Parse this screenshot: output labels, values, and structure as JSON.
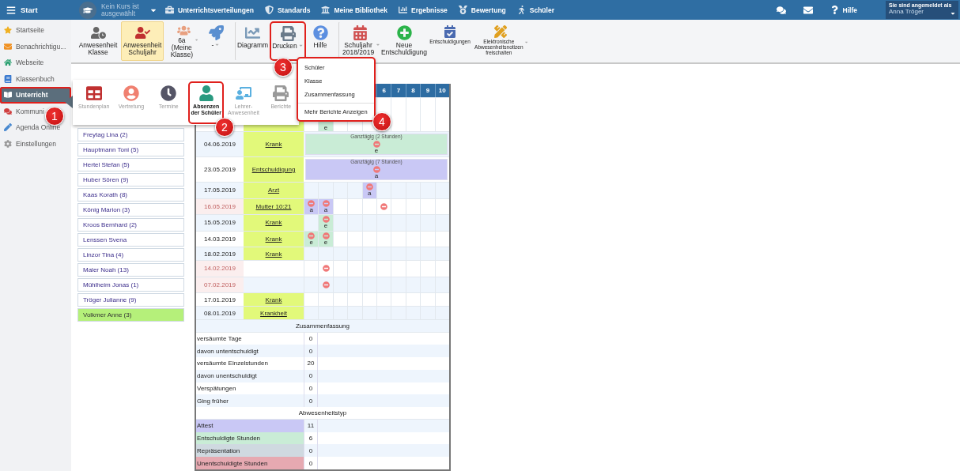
{
  "topbar": {
    "start": "Start",
    "course": "Kein Kurs ist ausgewählt",
    "nav": [
      "Unterrichtsverteilungen",
      "Standards",
      "Meine Bibliothek",
      "Ergebnisse",
      "Bewertung",
      "Schüler"
    ],
    "help": "Hilfe",
    "login_label": "Sie sind angemeldet als",
    "user": "Anna Tröger"
  },
  "sidebar": [
    {
      "label": "Startseite",
      "selected": false,
      "outlined": false
    },
    {
      "label": "Benachrichtigu...",
      "selected": false,
      "outlined": false
    },
    {
      "label": "Webseite",
      "selected": false,
      "outlined": false
    },
    {
      "label": "Klassenbuch",
      "selected": false,
      "outlined": false
    },
    {
      "label": "Unterricht",
      "selected": true,
      "outlined": true
    },
    {
      "label": "Kommuni",
      "selected": false,
      "outlined": false
    },
    {
      "label": "Agenda Online",
      "selected": false,
      "outlined": false
    },
    {
      "label": "Einstellungen",
      "selected": false,
      "outlined": false
    }
  ],
  "toolbar": [
    {
      "label": "Anwesenheit Klasse",
      "kind": "large",
      "selected": false,
      "dropdown": false,
      "divider_before": false,
      "outlined": false
    },
    {
      "label": "Anwesenheit Schuljahr",
      "kind": "large",
      "selected": true,
      "dropdown": false,
      "divider_before": false,
      "outlined": false
    },
    {
      "label": "6a (Meine Klasse)",
      "kind": "large",
      "selected": false,
      "dropdown": true,
      "divider_before": false,
      "outlined": false
    },
    {
      "label": "-",
      "kind": "large",
      "selected": false,
      "dropdown": true,
      "divider_before": false,
      "outlined": false
    },
    {
      "label": "Diagramm",
      "kind": "large",
      "selected": false,
      "dropdown": false,
      "divider_before": true,
      "outlined": false
    },
    {
      "label": "Drucken",
      "kind": "large",
      "selected": false,
      "dropdown": true,
      "divider_before": false,
      "outlined": true
    },
    {
      "label": "Hilfe",
      "kind": "large",
      "selected": false,
      "dropdown": false,
      "divider_before": false,
      "outlined": false
    },
    {
      "label": "Schuljahr 2018/2019",
      "kind": "large",
      "selected": false,
      "dropdown": true,
      "divider_before": true,
      "outlined": false
    },
    {
      "label": "Neue Entschuldigung",
      "kind": "large",
      "selected": false,
      "dropdown": false,
      "divider_before": false,
      "outlined": false
    },
    {
      "label": "Entschuldigungen",
      "kind": "small",
      "selected": false,
      "dropdown": false,
      "divider_before": false,
      "outlined": false
    },
    {
      "label": "Elektronische Abwesenheitsnotizen freischalten",
      "kind": "small",
      "selected": false,
      "dropdown": true,
      "divider_before": false,
      "outlined": false
    }
  ],
  "module_menu": [
    {
      "label": "Stundenplan",
      "selected": false,
      "outlined": false
    },
    {
      "label": "Vertretung",
      "selected": false,
      "outlined": false
    },
    {
      "label": "Termine",
      "selected": false,
      "outlined": false
    },
    {
      "label": "Absenzen der Schüler",
      "selected": true,
      "outlined": true
    },
    {
      "label": "Lehrer-Anwesenheit",
      "selected": false,
      "outlined": false
    },
    {
      "label": "Berichte",
      "selected": false,
      "outlined": false
    }
  ],
  "print_menu": {
    "items": [
      "Schüler",
      "Klasse",
      "Zusammenfassung"
    ],
    "more": "Mehr Berichte Anzeigen",
    "outlined": true
  },
  "callouts": [
    "1",
    "2",
    "3",
    "4"
  ],
  "students": [
    {
      "name": "Freytag Lina (2)",
      "selected": false
    },
    {
      "name": "Hauptmann Toni (5)",
      "selected": false
    },
    {
      "name": "Hertel Stefan (5)",
      "selected": false
    },
    {
      "name": "Huber Sören (9)",
      "selected": false
    },
    {
      "name": "Kaas Korath (8)",
      "selected": false
    },
    {
      "name": "König Marion (3)",
      "selected": false
    },
    {
      "name": "Kroos Bernhard (2)",
      "selected": false
    },
    {
      "name": "Lenssen Svena",
      "selected": false
    },
    {
      "name": "Linzor Tina (4)",
      "selected": false
    },
    {
      "name": "Maler Noah (13)",
      "selected": false
    },
    {
      "name": "Mühlheim Jonas (1)",
      "selected": false
    },
    {
      "name": "Tröger Julianne (9)",
      "selected": false
    },
    {
      "name": "Volkmer Anne (3)",
      "selected": true
    }
  ],
  "absences": {
    "periods": [
      "6",
      "7",
      "8",
      "9",
      "10"
    ],
    "rows": [
      {
        "kind": "covered",
        "cells": [
          {
            "kind": "empty"
          },
          {
            "kind": "letter",
            "letter": "e",
            "color": "#c9ecd6"
          },
          {
            "kind": "empty"
          },
          {
            "kind": "empty"
          },
          {
            "kind": "empty"
          },
          {
            "kind": "empty"
          },
          {
            "kind": "empty"
          },
          {
            "kind": "empty"
          },
          {
            "kind": "empty"
          },
          {
            "kind": "empty"
          }
        ]
      },
      {
        "kind": "full_day",
        "date": "04.06.2019",
        "reason": "Krank",
        "flagged": false,
        "full_day": {
          "label": "Ganztägig (2 Stunden)",
          "letter": "e",
          "color": "#c9ecd6"
        }
      },
      {
        "kind": "full_day",
        "date": "23.05.2019",
        "reason": "Entschuldigung",
        "flagged": false,
        "full_day": {
          "label": "Ganztägig (7 Stunden)",
          "letter": "a",
          "color": "#c9c8f5"
        }
      },
      {
        "kind": "periods",
        "date": "17.05.2019",
        "reason": "Arzt",
        "flagged": false,
        "cells": [
          {
            "kind": "empty"
          },
          {
            "kind": "empty"
          },
          {
            "kind": "empty"
          },
          {
            "kind": "empty"
          },
          {
            "kind": "mark",
            "letter": "a",
            "color": "#c9c8f5"
          },
          {
            "kind": "empty"
          },
          {
            "kind": "empty"
          },
          {
            "kind": "empty"
          },
          {
            "kind": "empty"
          },
          {
            "kind": "empty"
          }
        ]
      },
      {
        "kind": "periods",
        "date": "16.05.2019",
        "reason": "Mutter 10:21",
        "flagged": true,
        "cells": [
          {
            "kind": "mark",
            "letter": "a",
            "color": "#c9c8f5"
          },
          {
            "kind": "mark",
            "letter": "a",
            "color": "#c9c8f5"
          },
          {
            "kind": "empty"
          },
          {
            "kind": "empty"
          },
          {
            "kind": "empty"
          },
          {
            "kind": "icon"
          },
          {
            "kind": "empty"
          },
          {
            "kind": "empty"
          },
          {
            "kind": "empty"
          },
          {
            "kind": "empty"
          }
        ]
      },
      {
        "kind": "periods",
        "date": "15.05.2019",
        "reason": "Krank",
        "flagged": false,
        "cells": [
          {
            "kind": "empty"
          },
          {
            "kind": "mark",
            "letter": "e",
            "color": "#c9ecd6"
          },
          {
            "kind": "empty"
          },
          {
            "kind": "empty"
          },
          {
            "kind": "empty"
          },
          {
            "kind": "empty"
          },
          {
            "kind": "empty"
          },
          {
            "kind": "empty"
          },
          {
            "kind": "empty"
          },
          {
            "kind": "empty"
          }
        ]
      },
      {
        "kind": "periods",
        "date": "14.03.2019",
        "reason": "Krank",
        "flagged": false,
        "cells": [
          {
            "kind": "mark",
            "letter": "e",
            "color": "#c9ecd6"
          },
          {
            "kind": "mark",
            "letter": "e",
            "color": "#c9ecd6"
          },
          {
            "kind": "empty"
          },
          {
            "kind": "empty"
          },
          {
            "kind": "empty"
          },
          {
            "kind": "empty"
          },
          {
            "kind": "empty"
          },
          {
            "kind": "empty"
          },
          {
            "kind": "empty"
          },
          {
            "kind": "empty"
          }
        ]
      },
      {
        "kind": "periods",
        "date": "18.02.2019",
        "reason": "Krank",
        "flagged": false
      },
      {
        "kind": "periods",
        "date": "14.02.2019",
        "flagged": true,
        "cells": [
          {
            "kind": "empty"
          },
          {
            "kind": "icon"
          },
          {
            "kind": "empty"
          },
          {
            "kind": "empty"
          },
          {
            "kind": "empty"
          },
          {
            "kind": "empty"
          },
          {
            "kind": "empty"
          },
          {
            "kind": "empty"
          },
          {
            "kind": "empty"
          },
          {
            "kind": "empty"
          }
        ]
      },
      {
        "kind": "periods",
        "date": "07.02.2019",
        "flagged": true,
        "cells": [
          {
            "kind": "empty"
          },
          {
            "kind": "icon"
          },
          {
            "kind": "empty"
          },
          {
            "kind": "empty"
          },
          {
            "kind": "empty"
          },
          {
            "kind": "empty"
          },
          {
            "kind": "empty"
          },
          {
            "kind": "empty"
          },
          {
            "kind": "empty"
          },
          {
            "kind": "empty"
          }
        ]
      },
      {
        "kind": "periods",
        "date": "17.01.2019",
        "reason": "Krank",
        "flagged": false
      },
      {
        "kind": "periods",
        "date": "08.01.2019",
        "reason": "Krankheit",
        "flagged": false
      }
    ]
  },
  "summary": {
    "title": "Zusammenfassung",
    "rows": [
      {
        "label": "versäumte Tage",
        "value": "0"
      },
      {
        "label": "davon untentschuldigt",
        "value": "0"
      },
      {
        "label": "versäumte Einzelstunden",
        "value": "20"
      },
      {
        "label": "davon unentschuldigt",
        "value": "0"
      },
      {
        "label": "Verspätungen",
        "value": "0"
      },
      {
        "label": "Ging früher",
        "value": "0"
      }
    ]
  },
  "absence_types": {
    "title": "Abwesenheitstyp",
    "rows": [
      {
        "label": "Attest",
        "value": "11",
        "color": "#c9c8f5"
      },
      {
        "label": "Entschuldigte Stunden",
        "value": "6",
        "color": "#c9ecd6"
      },
      {
        "label": "Repräsentation",
        "value": "0",
        "color": "#cfd9e0"
      },
      {
        "label": "Unentschuldigte  Stunden",
        "value": "0",
        "color": "#e6a9b1"
      }
    ]
  }
}
